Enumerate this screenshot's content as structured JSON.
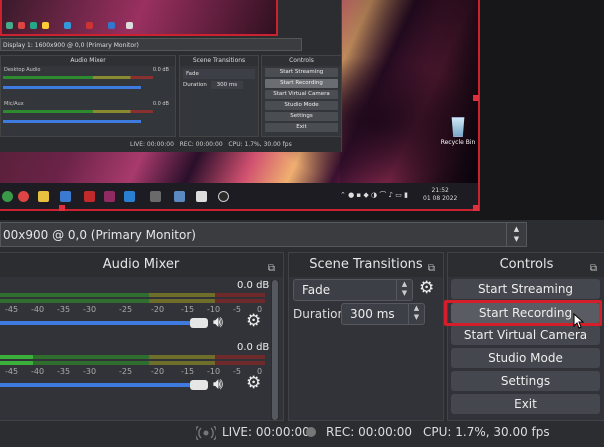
{
  "preview": {
    "inner": {
      "display_label": "Display 1: 1600x900 @ 0,0 (Primary Monitor)",
      "audio_mixer": "Audio Mixer",
      "scene_transitions": "Scene Transitions",
      "controls": "Controls",
      "desktop_audio": "Desktop Audio",
      "mic_aux": "Mic/Aux",
      "db1": "0.0 dB",
      "db2": "0.0 dB",
      "fade": "Fade",
      "duration": "Duration",
      "duration_val": "300 ms",
      "buttons": [
        "Start Streaming",
        "Start Recording",
        "Start Virtual Camera",
        "Studio Mode",
        "Settings",
        "Exit"
      ],
      "live": "LIVE: 00:00:00",
      "rec": "REC: 00:00:00",
      "cpu": "CPU: 1.7%, 30.00 fps"
    },
    "recycle_bin": "Recycle Bin",
    "clock_time": "21:52",
    "clock_date": "01 08 2022"
  },
  "display_source": {
    "label": "00x900 @ 0,0 (Primary Monitor)"
  },
  "audio_mixer": {
    "title": "Audio Mixer",
    "channels": [
      {
        "db": "0.0 dB",
        "volume_fraction": 1.0
      },
      {
        "db": "0.0 dB",
        "volume_fraction": 1.0
      }
    ],
    "ticks": [
      "-45",
      "-40",
      "-35",
      "-30",
      "-25",
      "-20",
      "-15",
      "-10",
      "-5",
      "0"
    ]
  },
  "scene_transitions": {
    "title": "Scene Transitions",
    "transition": "Fade",
    "duration_label": "Duration",
    "duration_value": "300 ms"
  },
  "controls": {
    "title": "Controls",
    "start_streaming": "Start Streaming",
    "start_recording": "Start Recording",
    "start_virtual_camera": "Start Virtual Camera",
    "studio_mode": "Studio Mode",
    "settings": "Settings",
    "exit": "Exit"
  },
  "status_bar": {
    "live": "LIVE: 00:00:00",
    "rec": "REC: 00:00:00",
    "cpu": "CPU: 1.7%, 30.00 fps"
  },
  "colors": {
    "accent_blue": "#3d7be0",
    "highlight_red": "#d41f2a",
    "meter_green": "#3aa53a",
    "meter_yellow": "#a8a838",
    "meter_red": "#a83838"
  }
}
